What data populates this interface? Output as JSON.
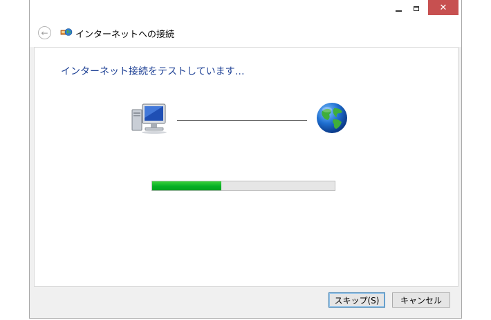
{
  "window": {
    "controls": {
      "minimize_icon": "minimize-icon",
      "maximize_icon": "maximize-icon",
      "close_glyph": "✕"
    }
  },
  "nav": {
    "back_glyph": "←",
    "icon": "network-globe-icon",
    "title": "インターネットへの接続"
  },
  "content": {
    "heading": "インターネット接続をテストしています…",
    "progress": 0.38,
    "progress_color": "#06b025",
    "icons": {
      "computer": "computer-icon",
      "internet": "globe-icon"
    }
  },
  "buttons": {
    "skip_label": "スキップ(S)",
    "cancel_label": "キャンセル"
  }
}
